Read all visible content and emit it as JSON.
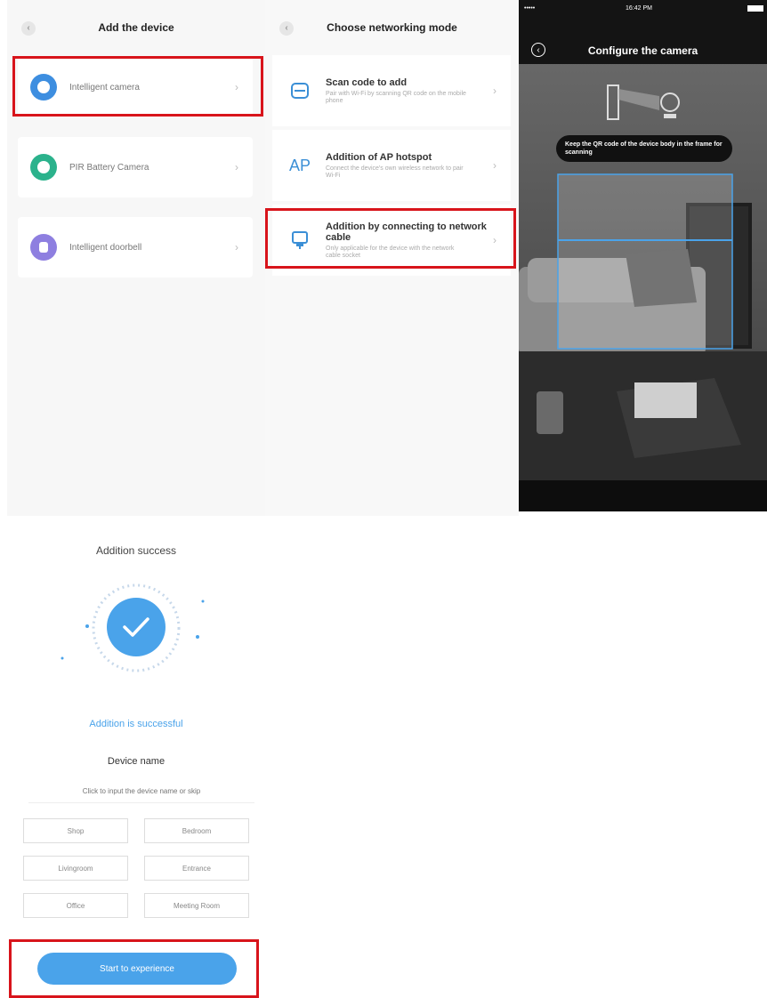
{
  "screen1": {
    "title": "Add the device",
    "devices": [
      {
        "label": "Intelligent camera",
        "icon": "camera-icon",
        "color": "#3d8ee0"
      },
      {
        "label": "PIR Battery Camera",
        "icon": "battery-camera-icon",
        "color": "#2bb28c"
      },
      {
        "label": "Intelligent doorbell",
        "icon": "doorbell-icon",
        "color": "#8e7fe0"
      }
    ]
  },
  "screen2": {
    "title": "Choose networking mode",
    "modes": [
      {
        "title": "Scan code to add",
        "desc": "Pair with Wi-Fi by scanning QR code on the mobile phone",
        "icon": "scan-icon"
      },
      {
        "title": "Addition of AP hotspot",
        "desc": "Connect the device's own wireless network to pair Wi-Fi",
        "icon_text": "AP",
        "icon": "ap-hotspot-icon"
      },
      {
        "title": "Addition by connecting to network cable",
        "desc": "Only applicable for the device with the network cable socket",
        "icon": "network-cable-icon"
      }
    ]
  },
  "screen3": {
    "carrier": "•••••",
    "time": "16:42 PM",
    "title": "Configure the camera",
    "hint": "Keep the QR code of the device body in the frame for scanning"
  },
  "screen4": {
    "title": "Addition success",
    "success_text": "Addition is successful",
    "device_name_label": "Device name",
    "name_placeholder": "Click to input the device name or skip",
    "rooms": [
      "Shop",
      "Bedroom",
      "Livingroom",
      "Entrance",
      "Office",
      "Meeting Room"
    ],
    "start_button": "Start to experience"
  },
  "colors": {
    "accent": "#4aa3ea",
    "highlight": "#d8141b"
  }
}
